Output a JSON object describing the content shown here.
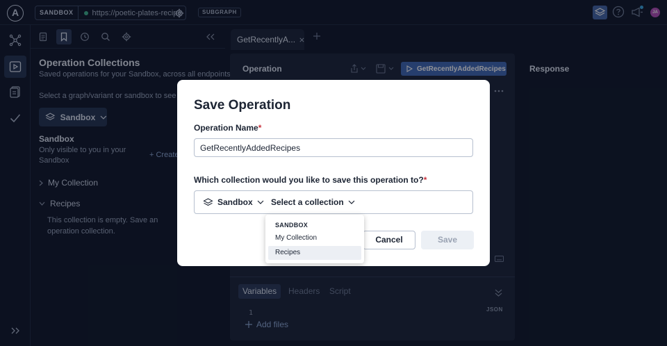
{
  "topbar": {
    "logo_letter": "A",
    "env_tag": "SANDBOX",
    "url": "https://poetic-plates-recipe",
    "subgraph_tag": "SUBGRAPH",
    "avatar_initials": "JA"
  },
  "sidebar": {
    "title": "Operation Collections",
    "subtitle": "Saved operations for your Sandbox, across all endpoints",
    "select_hint": "Select a graph/variant or sandbox to see its co",
    "graph_button": "Sandbox",
    "sandbox_heading": "Sandbox",
    "sandbox_desc": "Only visible to you in your Sandbox",
    "create_label": "+ Create",
    "collections": [
      {
        "label": "My Collection",
        "expanded": false
      },
      {
        "label": "Recipes",
        "expanded": true
      }
    ],
    "empty_text": "This collection is empty. Save an operation collection."
  },
  "main": {
    "tab_label": "GetRecentlyA...",
    "operation_title": "Operation",
    "run_label": "GetRecentlyAddedRecipes",
    "response_title": "Response",
    "var_tabs": [
      "Variables",
      "Headers",
      "Script"
    ],
    "line_number": "1",
    "json_label": "JSON",
    "add_files": "Add files"
  },
  "modal": {
    "title": "Save Operation",
    "name_label": "Operation Name",
    "required_mark": "*",
    "name_value": "GetRecentlyAddedRecipes",
    "collection_question": "Which collection would you like to save this operation to?",
    "picker_graph": "Sandbox",
    "picker_placeholder": "Select a collection",
    "cancel_label": "Cancel",
    "save_label": "Save"
  },
  "dropdown": {
    "heading": "SANDBOX",
    "items": [
      {
        "label": "My Collection",
        "hover": false
      },
      {
        "label": "Recipes",
        "hover": true
      }
    ]
  },
  "colors": {
    "background": "#0f1728",
    "panel": "#1a2438",
    "accent": "#3f68b5",
    "required": "#c8333d"
  }
}
